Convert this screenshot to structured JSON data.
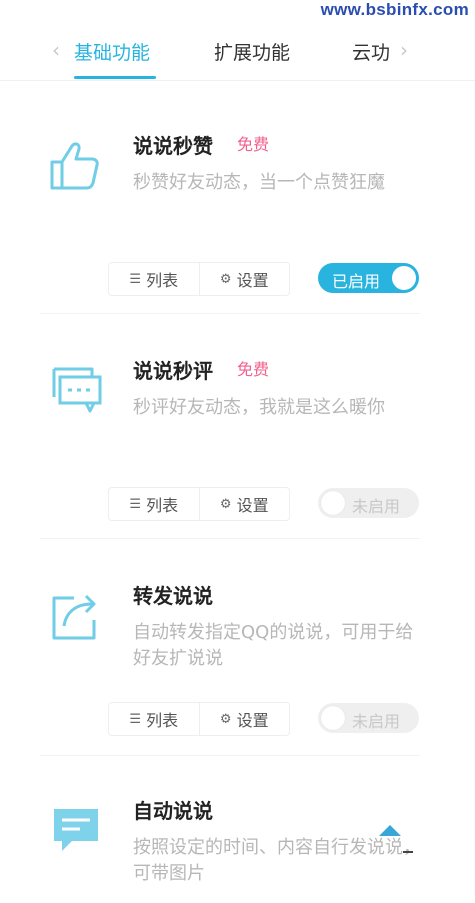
{
  "watermark": "www.bsbinfx.com",
  "tabs": {
    "left_chevron": "‹",
    "right_chevron": "›",
    "items": [
      {
        "label": "基础功能"
      },
      {
        "label": "扩展功能"
      },
      {
        "label": "云功"
      }
    ]
  },
  "colors": {
    "accent": "#29b4e0",
    "free_badge": "#f0628e"
  },
  "features": [
    {
      "icon": "thumbs-up-icon",
      "title": "说说秒赞",
      "badge": "免费",
      "desc": "秒赞好友动态，当一个点赞狂魔",
      "list_label": "列表",
      "settings_label": "设置",
      "toggle_label": "已启用",
      "enabled": true
    },
    {
      "icon": "chat-bubbles-icon",
      "title": "说说秒评",
      "badge": "免费",
      "desc": "秒评好友动态，我就是这么暖你",
      "list_label": "列表",
      "settings_label": "设置",
      "toggle_label": "未启用",
      "enabled": false
    },
    {
      "icon": "share-icon",
      "title": "转发说说",
      "desc": "自动转发指定QQ的说说，可用于给好友扩说说",
      "list_label": "列表",
      "settings_label": "设置",
      "toggle_label": "未启用",
      "enabled": false
    },
    {
      "icon": "message-icon",
      "title": "自动说说",
      "desc": "按照设定的时间、内容自行发说说，可带图片"
    }
  ]
}
